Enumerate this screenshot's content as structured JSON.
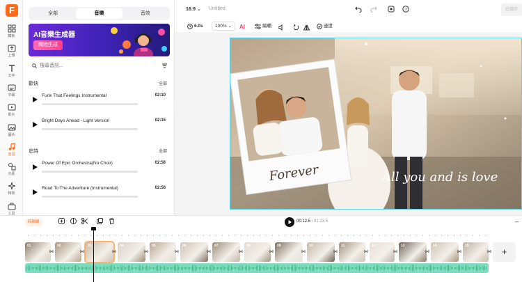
{
  "app": {
    "logo_letter": "F",
    "rail": [
      {
        "icon": "grid-icon",
        "label": "模板"
      },
      {
        "icon": "upload-icon",
        "label": "上傳"
      },
      {
        "icon": "text-icon",
        "label": "文字"
      },
      {
        "icon": "subtitle-icon",
        "label": "字幕"
      },
      {
        "icon": "video-icon",
        "label": "影片"
      },
      {
        "icon": "image-icon",
        "label": "圖片"
      },
      {
        "icon": "music-icon",
        "label": "音訊",
        "active": true
      },
      {
        "icon": "elements-icon",
        "label": "元素"
      },
      {
        "icon": "effects-icon",
        "label": "特效"
      },
      {
        "icon": "tools-icon",
        "label": "工具"
      }
    ]
  },
  "panel": {
    "tabs": [
      {
        "label": "全部",
        "active": false
      },
      {
        "label": "音樂",
        "active": true
      },
      {
        "label": "音效",
        "active": false
      }
    ],
    "banner": {
      "title": "AI音樂生成器",
      "button": "開始生成"
    },
    "search": {
      "placeholder": "搜尋音訊..."
    },
    "sections": [
      {
        "title": "歡快",
        "all_label": "全部",
        "tracks": [
          {
            "name": "Funk That Feelings Instrumental",
            "duration": "02:10"
          },
          {
            "name": "Bright Days Ahead - Light Version",
            "duration": "02:15"
          }
        ]
      },
      {
        "title": "史詩",
        "all_label": "全部",
        "tracks": [
          {
            "name": "Power Of Epic Orchestra(No Choir)",
            "duration": "02:56"
          },
          {
            "name": "Road To The Adventure (Instrumental)",
            "duration": "02:56"
          }
        ]
      }
    ]
  },
  "topbar": {
    "ratio": "16:9",
    "title": "Untitled",
    "export": "已儲存"
  },
  "toolbar": {
    "duration": "6.0s",
    "zoom": "100%",
    "edit": "編輯",
    "speed": "速度"
  },
  "canvas": {
    "polaroid_caption": "Forever",
    "overlay_text": "All you and is love"
  },
  "timeline": {
    "chip": "時間線",
    "current_time": "00:12.5",
    "total_time": "/ 01:23.5",
    "clip_numbers": [
      "01",
      "02",
      "03",
      "04",
      "05",
      "06",
      "07",
      "08",
      "09",
      "10",
      "11",
      "12",
      "13",
      "14",
      "15"
    ],
    "selected_clip": "03",
    "add_label": "+"
  },
  "colors": {
    "brand": "#ff6b1a",
    "audio_track": "#7fdcc0",
    "canvas_border": "#5ad3ea"
  }
}
